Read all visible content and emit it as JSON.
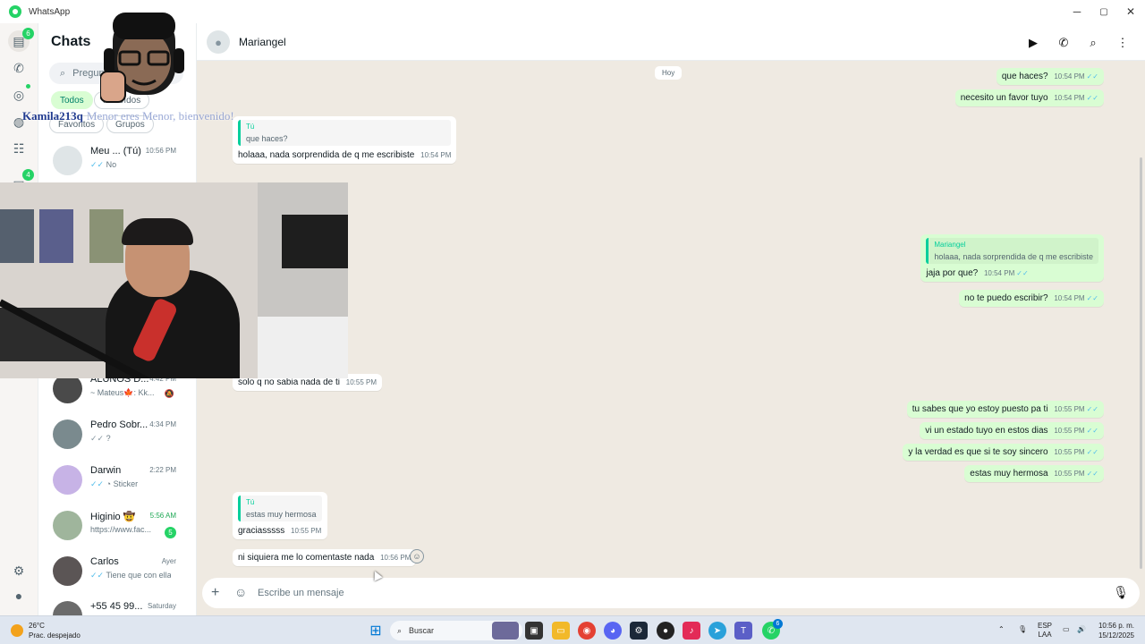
{
  "window": {
    "title": "WhatsApp",
    "controls": [
      "─",
      "▢",
      "✕"
    ]
  },
  "rail": {
    "chats_badge": "6",
    "communities_badge": "4",
    "icons": [
      "chats-icon",
      "calls-icon",
      "status-icon",
      "channels-icon",
      "communities-icon",
      "archive-icon",
      "settings-icon",
      "profile-icon"
    ]
  },
  "sidebar": {
    "title": "Chats",
    "search_placeholder": "Pregunta",
    "filters": [
      "Todos",
      "No leídos",
      "Favoritos",
      "Grupos"
    ],
    "chats": [
      {
        "name": "Meu ...",
        "name_suffix": "(Tú)",
        "time": "10:56 PM",
        "preview": "No",
        "ticks": "✓✓"
      },
      {
        "name": "ALUNOS D...",
        "time": "4:42 PM",
        "preview": "~ Mateus🍁: Kk...",
        "muted": true
      },
      {
        "name": "Pedro Sobr...",
        "time": "4:34 PM",
        "preview": "?",
        "ticks": "✓✓"
      },
      {
        "name": "Darwin",
        "time": "2:22 PM",
        "preview": "Sticker",
        "ticks": "✓✓"
      },
      {
        "name": "Higinio 🤠",
        "time": "5:56 AM",
        "preview": "https://www.fac...",
        "unread": "5"
      },
      {
        "name": "Carlos",
        "time": "Ayer",
        "preview": "Tiene que con ella",
        "ticks": "✓✓"
      },
      {
        "name": "+55 45 99...",
        "time": "Saturday",
        "preview": ""
      }
    ]
  },
  "header": {
    "contact_name": "Mariangel"
  },
  "conversation": {
    "date_label": "Hoy",
    "messages": [
      {
        "dir": "out",
        "text": "que haces?",
        "time": "10:54 PM"
      },
      {
        "dir": "out",
        "text": "necesito un favor tuyo",
        "time": "10:54 PM"
      },
      {
        "dir": "in",
        "quote_author": "Tú",
        "quote_text": "que haces?",
        "text": "holaaa, nada sorprendida de q me escribiste",
        "time": "10:54 PM"
      },
      {
        "dir": "out",
        "quote_author": "Mariangel",
        "quote_text": "holaaa, nada sorprendida de q me escribiste",
        "text": "jaja por que?",
        "time": "10:54 PM"
      },
      {
        "dir": "out",
        "text": "no te puedo escribir?",
        "time": "10:54 PM"
      },
      {
        "dir": "in",
        "text": "solo q no sabia nada de ti",
        "time": "10:55 PM"
      },
      {
        "dir": "out",
        "text": "tu sabes que yo estoy puesto pa ti",
        "time": "10:55 PM"
      },
      {
        "dir": "out",
        "text": "vi un estado tuyo en estos dias",
        "time": "10:55 PM"
      },
      {
        "dir": "out",
        "text": "y la verdad es que si te soy sincero",
        "time": "10:55 PM"
      },
      {
        "dir": "out",
        "text": "estas muy hermosa",
        "time": "10:55 PM"
      },
      {
        "dir": "in",
        "quote_author": "Tú",
        "quote_text": "estas muy hermosa",
        "text": "graciasssss",
        "time": "10:55 PM"
      },
      {
        "dir": "in",
        "text": "ni siquiera me lo comentaste nada",
        "time": "10:56 PM"
      }
    ]
  },
  "composer": {
    "placeholder": "Escribe un mensaje"
  },
  "overlay": {
    "username": "Kamila213q",
    "message": "Menor eres Menor, bienvenido!"
  },
  "taskbar": {
    "temperature": "26°C",
    "weather": "Prac. despejado",
    "search_label": "Buscar",
    "language": "ESP",
    "layout": "LAA",
    "time": "10:56 p. m.",
    "date": "15/12/2025",
    "whatsapp_badge": "6"
  },
  "colors": {
    "accent": "#25d366",
    "outgoing": "#d9fdd3",
    "background": "#efeae2",
    "tick": "#53bdeb"
  }
}
